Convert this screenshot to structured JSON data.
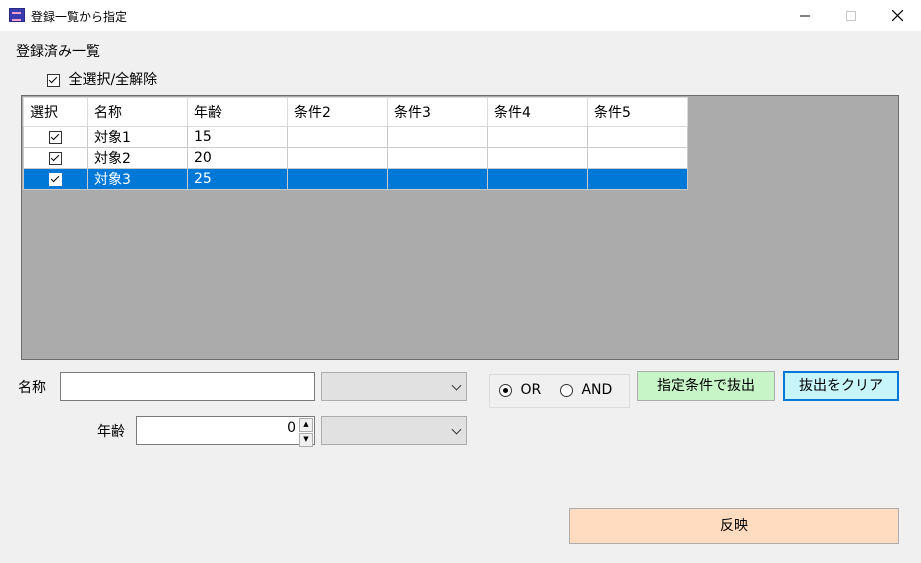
{
  "window": {
    "title": "登録一覧から指定",
    "minimize_icon": "minimize-icon",
    "maximize_icon": "maximize-icon",
    "close_icon": "close-icon"
  },
  "list": {
    "heading": "登録済み一覧",
    "select_all_label": "全選択/全解除",
    "select_all_checked": true,
    "columns": [
      "選択",
      "名称",
      "年齢",
      "条件2",
      "条件3",
      "条件4",
      "条件5"
    ],
    "rows": [
      {
        "checked": true,
        "name": "対象1",
        "age": "15",
        "c2": "",
        "c3": "",
        "c4": "",
        "c5": "",
        "selected": false
      },
      {
        "checked": true,
        "name": "対象2",
        "age": "20",
        "c2": "",
        "c3": "",
        "c4": "",
        "c5": "",
        "selected": false
      },
      {
        "checked": true,
        "name": "対象3",
        "age": "25",
        "c2": "",
        "c3": "",
        "c4": "",
        "c5": "",
        "selected": true
      }
    ]
  },
  "filter": {
    "name_label": "名称",
    "name_value": "",
    "name_combo_value": "",
    "age_label": "年齢",
    "age_value": "0",
    "age_combo_value": "",
    "or_label": "OR",
    "and_label": "AND",
    "mode": "OR",
    "extract_button": "指定条件で抜出",
    "clear_button": "抜出をクリア"
  },
  "apply_button": "反映",
  "colors": {
    "selection": "#0078d7",
    "extract_bg": "#c8f5c8",
    "clear_bg": "#c8f5fa",
    "apply_bg": "#ffdcc0"
  }
}
